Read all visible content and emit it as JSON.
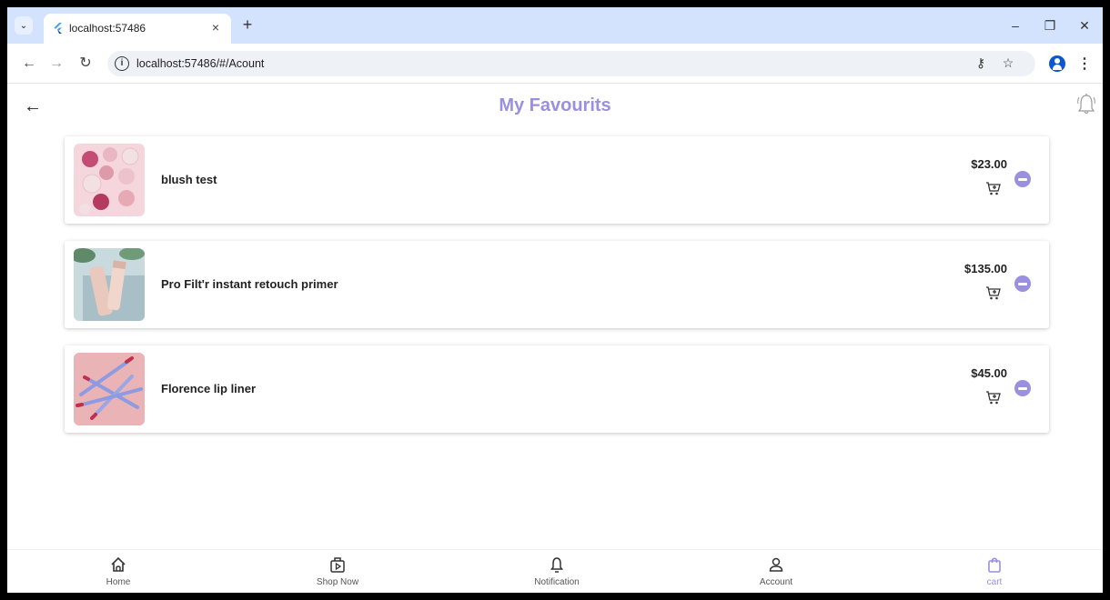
{
  "browser": {
    "tab_title": "localhost:57486",
    "url": "localhost:57486/#/Acount",
    "tab_close": "×",
    "new_tab": "+",
    "minimize": "–",
    "restore": "❐",
    "close": "✕"
  },
  "header": {
    "title": "My Favourits",
    "back": "←"
  },
  "favourites": [
    {
      "name": "blush test",
      "price": "$23.00"
    },
    {
      "name": "Pro Filt'r instant retouch primer",
      "price": "$135.00"
    },
    {
      "name": "Florence lip liner",
      "price": "$45.00"
    }
  ],
  "bottom_nav": [
    {
      "label": "Home",
      "icon": "home-icon"
    },
    {
      "label": "Shop Now",
      "icon": "shop-now-icon"
    },
    {
      "label": "Notification",
      "icon": "notification-icon"
    },
    {
      "label": "Account",
      "icon": "account-icon"
    },
    {
      "label": "cart",
      "icon": "cart-bag-icon",
      "active": true
    }
  ],
  "colors": {
    "accent": "#9a8fe0",
    "tabstrip": "#d3e3fd"
  }
}
